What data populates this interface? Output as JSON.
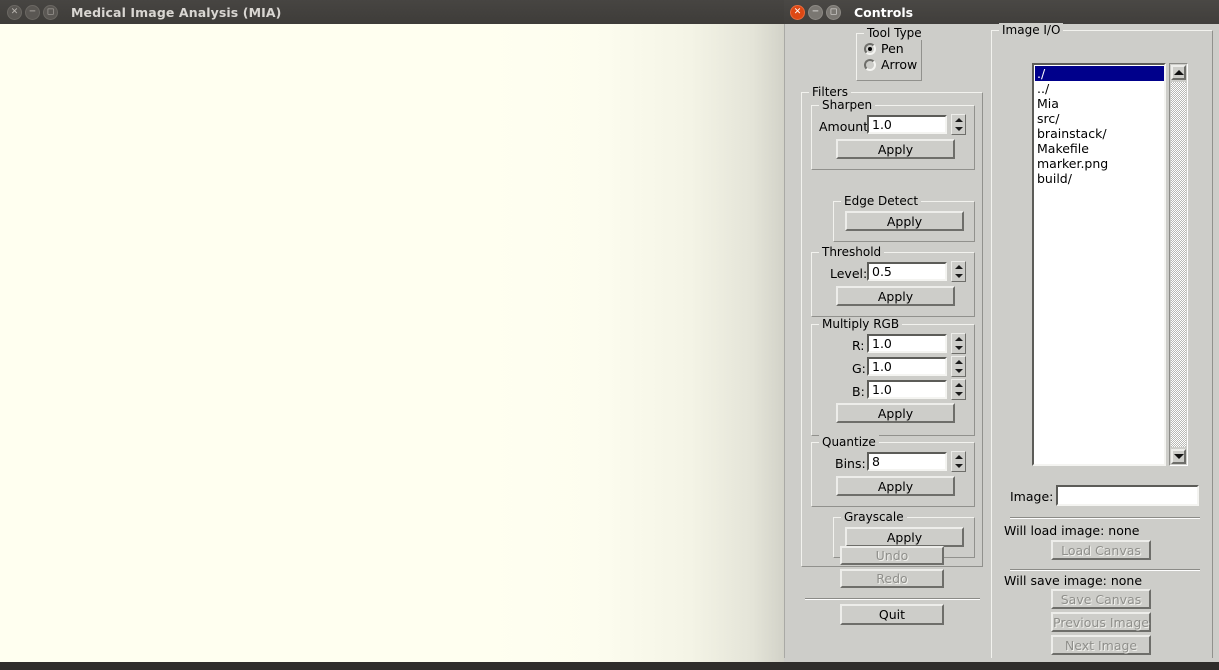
{
  "main_window": {
    "title": "Medical Image Analysis (MIA)",
    "close_icon": "close-icon",
    "minimize_icon": "minimize-icon",
    "maximize_icon": "maximize-icon",
    "canvas_color": "#fffff0"
  },
  "controls_window": {
    "title": "Controls",
    "close_icon": "close-icon",
    "minimize_icon": "minimize-icon",
    "maximize_icon": "maximize-icon",
    "accent_color": "#dd4814"
  },
  "tool_type": {
    "legend": "Tool Type",
    "options": [
      {
        "label": "Pen",
        "selected": true
      },
      {
        "label": "Arrow",
        "selected": false
      }
    ]
  },
  "filters": {
    "legend": "Filters",
    "sharpen": {
      "legend": "Sharpen",
      "field_label": "Amount:",
      "value": "1.0",
      "apply_label": "Apply"
    },
    "edge_detect": {
      "legend": "Edge Detect",
      "apply_label": "Apply"
    },
    "threshold": {
      "legend": "Threshold",
      "field_label": "Level:",
      "value": "0.5",
      "apply_label": "Apply"
    },
    "multiply_rgb": {
      "legend": "Multiply RGB",
      "r_label": "R:",
      "r_value": "1.0",
      "g_label": "G:",
      "g_value": "1.0",
      "b_label": "B:",
      "b_value": "1.0",
      "apply_label": "Apply"
    },
    "quantize": {
      "legend": "Quantize",
      "field_label": "Bins:",
      "value": "8",
      "apply_label": "Apply"
    },
    "grayscale": {
      "legend": "Grayscale",
      "apply_label": "Apply"
    }
  },
  "history": {
    "undo_label": "Undo",
    "undo_enabled": false,
    "redo_label": "Redo",
    "redo_enabled": false
  },
  "quit": {
    "label": "Quit"
  },
  "image_io": {
    "legend": "Image I/O",
    "file_list": [
      {
        "name": "./",
        "selected": true
      },
      {
        "name": "../",
        "selected": false
      },
      {
        "name": "Mia",
        "selected": false
      },
      {
        "name": "src/",
        "selected": false
      },
      {
        "name": "brainstack/",
        "selected": false
      },
      {
        "name": "Makefile",
        "selected": false
      },
      {
        "name": "marker.png",
        "selected": false
      },
      {
        "name": "build/",
        "selected": false
      }
    ],
    "selection_color": "#00008b",
    "image_field_label": "Image:",
    "image_field_value": "",
    "will_load_text": "Will load image: none",
    "load_canvas_label": "Load Canvas",
    "load_canvas_enabled": false,
    "will_save_text": "Will save image: none",
    "save_canvas_label": "Save Canvas",
    "save_canvas_enabled": false,
    "previous_image_label": "Previous Image",
    "previous_image_enabled": false,
    "next_image_label": "Next Image",
    "next_image_enabled": false
  },
  "taskbar": {
    "text": ""
  }
}
